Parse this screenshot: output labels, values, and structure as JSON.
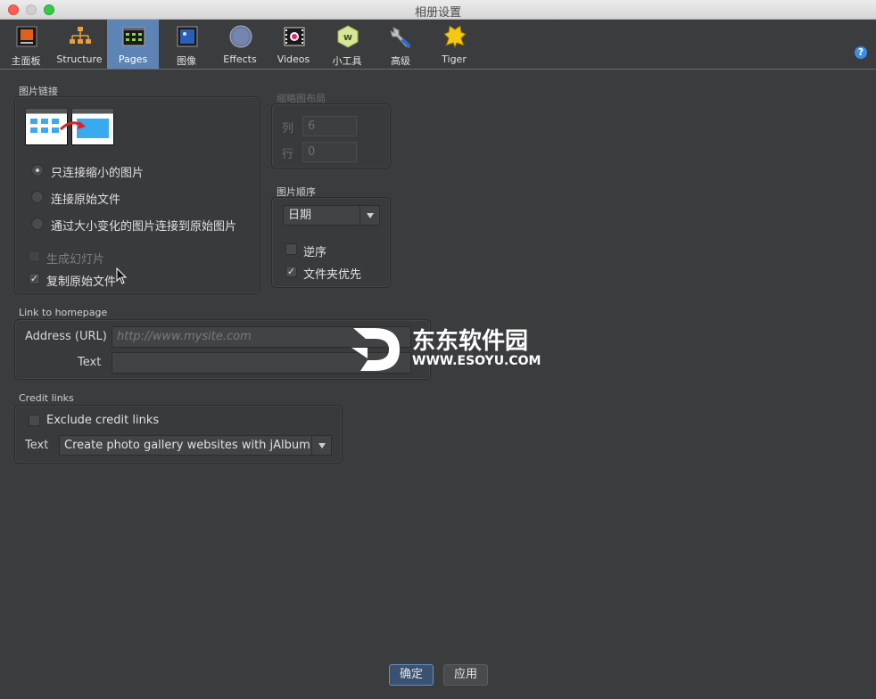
{
  "window": {
    "title": "相册设置"
  },
  "toolbar": {
    "items": [
      {
        "id": "main",
        "label": "主面板",
        "active": false
      },
      {
        "id": "structure",
        "label": "Structure",
        "active": false
      },
      {
        "id": "pages",
        "label": "Pages",
        "active": true
      },
      {
        "id": "images",
        "label": "图像",
        "active": false
      },
      {
        "id": "effects",
        "label": "Effects",
        "active": false
      },
      {
        "id": "videos",
        "label": "Videos",
        "active": false
      },
      {
        "id": "tools",
        "label": "小工具",
        "active": false
      },
      {
        "id": "advanced",
        "label": "高级",
        "active": false
      },
      {
        "id": "tiger",
        "label": "Tiger",
        "active": false
      }
    ],
    "help_label": "?"
  },
  "image_links": {
    "title": "图片链接",
    "options": [
      "只连接缩小的图片",
      "连接原始文件",
      "通过大小变化的图片连接到原始图片"
    ],
    "selected_index": 0,
    "slideshow_label": "生成幻灯片",
    "slideshow_checked": false,
    "copy_originals_label": "复制原始文件",
    "copy_originals_checked": true
  },
  "thumbnail_layout": {
    "title": "缩略图布局",
    "columns_label": "列",
    "columns_value": "6",
    "rows_label": "行",
    "rows_value": "0"
  },
  "image_order": {
    "title": "图片顺序",
    "sort_by": "日期",
    "reverse_label": "逆序",
    "reverse_checked": false,
    "folders_first_label": "文件夹优先",
    "folders_first_checked": true
  },
  "homepage_link": {
    "title": "Link to homepage",
    "address_label": "Address (URL)",
    "address_placeholder": "http://www.mysite.com",
    "address_value": "",
    "text_label": "Text",
    "text_value": ""
  },
  "credit_links": {
    "title": "Credit links",
    "exclude_label": "Exclude credit links",
    "exclude_checked": false,
    "text_label": "Text",
    "text_value": "Create photo gallery websites with jAlbum"
  },
  "buttons": {
    "ok": "确定",
    "apply": "应用"
  },
  "watermark": {
    "brand": "东东软件园",
    "url": "WWW.ESOYU.COM"
  },
  "colors": {
    "accent": "#5d84b4",
    "background": "#3b3c3e",
    "help": "#3a8ee6"
  }
}
